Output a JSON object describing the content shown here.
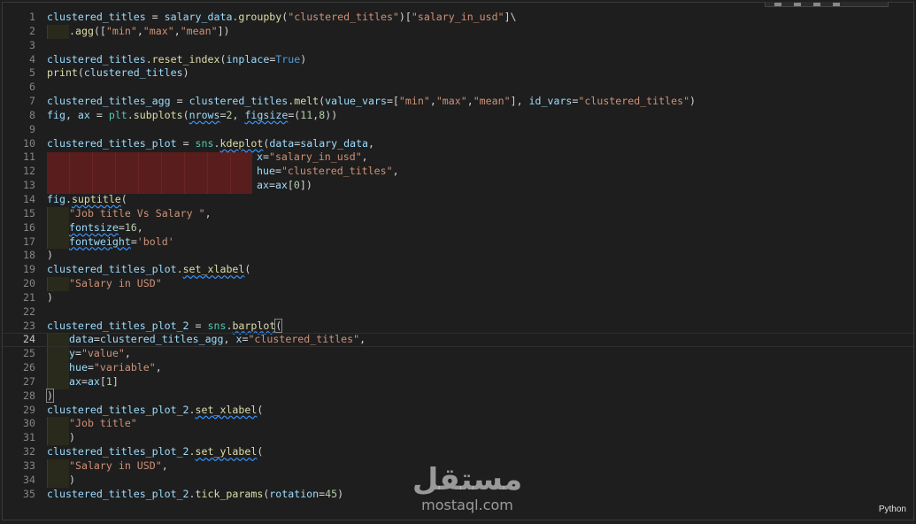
{
  "editor": {
    "language": "Python",
    "current_line": 24,
    "lines": [
      {
        "n": "1",
        "t": "clustered_titles = salary_data.groupby(\"clustered_titles\")[\"salary_in_usd\"]\\"
      },
      {
        "n": "2",
        "t": ".agg([\"min\",\"max\",\"mean\"])"
      },
      {
        "n": "3",
        "t": ""
      },
      {
        "n": "4",
        "t": "clustered_titles.reset_index(inplace=True)"
      },
      {
        "n": "5",
        "t": "print(clustered_titles)"
      },
      {
        "n": "6",
        "t": ""
      },
      {
        "n": "7",
        "t": "clustered_titles_agg = clustered_titles.melt(value_vars=[\"min\",\"max\",\"mean\"], id_vars=\"clustered_titles\")"
      },
      {
        "n": "8",
        "t": "fig, ax = plt.subplots(nrows=2, figsize=(11,8))"
      },
      {
        "n": "9",
        "t": ""
      },
      {
        "n": "10",
        "t": "clustered_titles_plot = sns.kdeplot(data=salary_data,"
      },
      {
        "n": "11",
        "t": "x=\"salary_in_usd\","
      },
      {
        "n": "12",
        "t": "hue=\"clustered_titles\","
      },
      {
        "n": "13",
        "t": "ax=ax[0])"
      },
      {
        "n": "14",
        "t": "fig.suptitle("
      },
      {
        "n": "15",
        "t": "\"Job title Vs Salary \","
      },
      {
        "n": "16",
        "t": "fontsize=16,"
      },
      {
        "n": "17",
        "t": "fontweight='bold'"
      },
      {
        "n": "18",
        "t": ")"
      },
      {
        "n": "19",
        "t": "clustered_titles_plot.set_xlabel("
      },
      {
        "n": "20",
        "t": "\"Salary in USD\""
      },
      {
        "n": "21",
        "t": ")"
      },
      {
        "n": "22",
        "t": ""
      },
      {
        "n": "23",
        "t": "clustered_titles_plot_2 = sns.barplot("
      },
      {
        "n": "24",
        "t": "data=clustered_titles_agg, x=\"clustered_titles\","
      },
      {
        "n": "25",
        "t": "y=\"value\","
      },
      {
        "n": "26",
        "t": "hue=\"variable\","
      },
      {
        "n": "27",
        "t": "ax=ax[1]"
      },
      {
        "n": "28",
        "t": ")"
      },
      {
        "n": "29",
        "t": "clustered_titles_plot_2.set_xlabel("
      },
      {
        "n": "30",
        "t": "\"Job title\""
      },
      {
        "n": "31",
        "t": ")"
      },
      {
        "n": "32",
        "t": "clustered_titles_plot_2.set_ylabel("
      },
      {
        "n": "33",
        "t": "\"Salary in USD\","
      },
      {
        "n": "34",
        "t": ")"
      },
      {
        "n": "35",
        "t": "clustered_titles_plot_2.tick_params(rotation=45)"
      }
    ]
  },
  "watermark": {
    "arabic": "مستقل",
    "latin": "mostaql.com"
  },
  "colors": {
    "background": "#1e1e1e",
    "variable": "#9cdcfe",
    "function": "#dcdcaa",
    "string": "#ce9178",
    "keyword": "#569cd6",
    "number": "#b5cea8",
    "selection_highlight": "#5a1d1d"
  }
}
